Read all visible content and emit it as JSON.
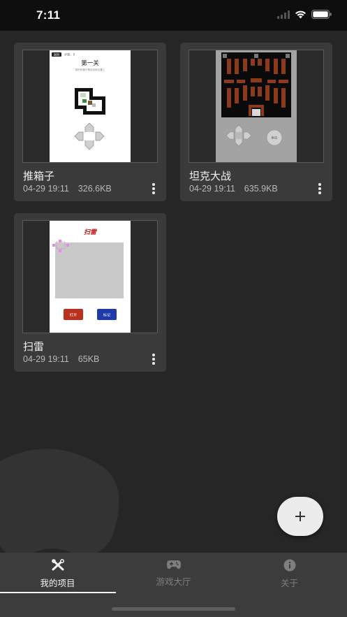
{
  "status_bar": {
    "time": "7:11"
  },
  "projects": [
    {
      "title": "推箱子",
      "date": "04-29 19:11",
      "size": "326.6KB",
      "preview": {
        "tag": "返回",
        "step_label": "步数：0",
        "level_title": "第一关",
        "hint": "将所有箱子推到目标位置上"
      }
    },
    {
      "title": "坦克大战",
      "date": "04-29 19:11",
      "size": "635.9KB",
      "preview": {
        "fire_button": "射击"
      }
    },
    {
      "title": "扫雷",
      "date": "04-29 19:11",
      "size": "65KB",
      "preview": {
        "heading": "扫雷",
        "open_button": "打开",
        "flag_button": "标记"
      }
    }
  ],
  "fab": {
    "icon": "plus-icon"
  },
  "bottom_nav": {
    "items": [
      {
        "label": "我的项目",
        "icon": "tools-icon",
        "active": true
      },
      {
        "label": "游戏大厅",
        "icon": "gamepad-icon",
        "active": false
      },
      {
        "label": "关于",
        "icon": "info-icon",
        "active": false
      }
    ]
  },
  "colors": {
    "accent": "#f3f3f3",
    "card_bg": "#3a3a3a",
    "page_bg": "#262626",
    "nav_bg": "#3c3c3c",
    "inactive": "#7e7e7e"
  }
}
